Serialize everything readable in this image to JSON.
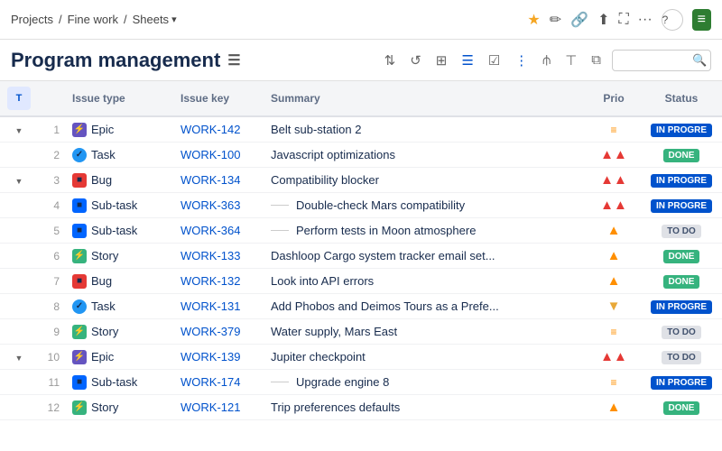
{
  "breadcrumb": {
    "projects": "Projects",
    "sep1": "/",
    "fine_work": "Fine work",
    "sep2": "/",
    "sheets": "Sheets",
    "chevron": "▾"
  },
  "top_icons": {
    "star": "★",
    "edit": "✏",
    "share": "⋮",
    "upload": "⬆",
    "expand": "⤢",
    "more": "···",
    "help": "?",
    "logo": "≡"
  },
  "page_title": "Program management",
  "page_title_icon": "≡",
  "toolbar": {
    "icons": [
      "⇅",
      "↺",
      "⊞",
      "≡",
      "☑",
      "⋮",
      "⊟",
      "▤",
      "⧈",
      "🔍"
    ]
  },
  "table": {
    "columns": [
      {
        "id": "expand",
        "label": ""
      },
      {
        "id": "num",
        "label": ""
      },
      {
        "id": "issue_type",
        "label": "Issue type"
      },
      {
        "id": "issue_key",
        "label": "Issue key"
      },
      {
        "id": "summary",
        "label": "Summary"
      },
      {
        "id": "prio",
        "label": "Prio"
      },
      {
        "id": "status",
        "label": "Status"
      }
    ],
    "rows": [
      {
        "id": 1,
        "expand": true,
        "type": "Epic",
        "type_class": "type-epic",
        "type_icon": "⚡",
        "key": "WORK-142",
        "summary": "Belt sub-station 2",
        "indent": 0,
        "prio": "medium-eq",
        "status": "IN PROGRE",
        "status_class": "status-inprogress"
      },
      {
        "id": 2,
        "expand": false,
        "type": "Task",
        "type_class": "type-task",
        "type_icon": "✓",
        "key": "WORK-100",
        "summary": "Javascript optimizations",
        "indent": 0,
        "prio": "high",
        "status": "DONE",
        "status_class": "status-done"
      },
      {
        "id": 3,
        "expand": true,
        "type": "Bug",
        "type_class": "type-bug",
        "type_icon": "⬛",
        "key": "WORK-134",
        "summary": "Compatibility blocker",
        "indent": 0,
        "prio": "high",
        "status": "IN PROGRE",
        "status_class": "status-inprogress"
      },
      {
        "id": 4,
        "expand": false,
        "type": "Sub-task",
        "type_class": "type-subtask",
        "type_icon": "⬛",
        "key": "WORK-363",
        "summary": "Double-check Mars compatibility",
        "indent": 1,
        "prio": "high",
        "status": "IN PROGRE",
        "status_class": "status-inprogress"
      },
      {
        "id": 5,
        "expand": false,
        "type": "Sub-task",
        "type_class": "type-subtask",
        "type_icon": "⬛",
        "key": "WORK-364",
        "summary": "Perform tests in Moon atmosphere",
        "indent": 1,
        "prio": "medium",
        "status": "TO DO",
        "status_class": "status-todo"
      },
      {
        "id": 6,
        "expand": false,
        "type": "Story",
        "type_class": "type-story",
        "type_icon": "⚡",
        "key": "WORK-133",
        "summary": "Dashloop Cargo system tracker email set...",
        "indent": 0,
        "prio": "medium",
        "status": "DONE",
        "status_class": "status-done"
      },
      {
        "id": 7,
        "expand": false,
        "type": "Bug",
        "type_class": "type-bug",
        "type_icon": "⬛",
        "key": "WORK-132",
        "summary": "Look into API errors",
        "indent": 0,
        "prio": "medium",
        "status": "DONE",
        "status_class": "status-done"
      },
      {
        "id": 8,
        "expand": false,
        "type": "Task",
        "type_class": "type-task",
        "type_icon": "✓",
        "key": "WORK-131",
        "summary": "Add Phobos and Deimos Tours as a Prefe...",
        "indent": 0,
        "prio": "low",
        "status": "IN PROGRE",
        "status_class": "status-inprogress"
      },
      {
        "id": 9,
        "expand": false,
        "type": "Story",
        "type_class": "type-story",
        "type_icon": "⚡",
        "key": "WORK-379",
        "summary": "Water supply, Mars East",
        "indent": 0,
        "prio": "medium-eq",
        "status": "TO DO",
        "status_class": "status-todo"
      },
      {
        "id": 10,
        "expand": true,
        "type": "Epic",
        "type_class": "type-epic",
        "type_icon": "⚡",
        "key": "WORK-139",
        "summary": "Jupiter checkpoint",
        "indent": 0,
        "prio": "high",
        "status": "TO DO",
        "status_class": "status-todo"
      },
      {
        "id": 11,
        "expand": false,
        "type": "Sub-task",
        "type_class": "type-subtask",
        "type_icon": "⬛",
        "key": "WORK-174",
        "summary": "Upgrade engine 8",
        "indent": 1,
        "prio": "medium-eq",
        "status": "IN PROGRE",
        "status_class": "status-inprogress"
      },
      {
        "id": 12,
        "expand": false,
        "type": "Story",
        "type_class": "type-story",
        "type_icon": "⚡",
        "key": "WORK-121",
        "summary": "Trip preferences defaults",
        "indent": 0,
        "prio": "medium",
        "status": "DONE",
        "status_class": "status-done"
      }
    ]
  }
}
